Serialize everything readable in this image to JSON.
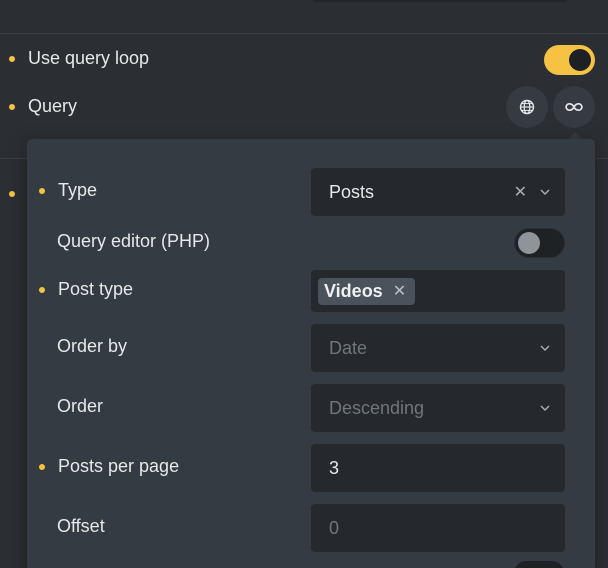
{
  "query_loop": {
    "label": "Use query loop",
    "enabled": true
  },
  "query": {
    "label": "Query",
    "icons": [
      "globe-icon",
      "infinity-icon"
    ]
  },
  "popover": {
    "type": {
      "label": "Type",
      "value": "Posts"
    },
    "query_editor": {
      "label": "Query editor (PHP)",
      "enabled": false
    },
    "post_type": {
      "label": "Post type",
      "tags": [
        "Videos"
      ]
    },
    "order_by": {
      "label": "Order by",
      "placeholder": "Date"
    },
    "order": {
      "label": "Order",
      "placeholder": "Descending"
    },
    "posts_per_page": {
      "label": "Posts per page",
      "value": "3"
    },
    "offset": {
      "label": "Offset",
      "placeholder": "0"
    }
  },
  "colors": {
    "accent": "#f5c243",
    "background": "#2b2f33",
    "popover": "#343b42",
    "field": "#25292d"
  }
}
